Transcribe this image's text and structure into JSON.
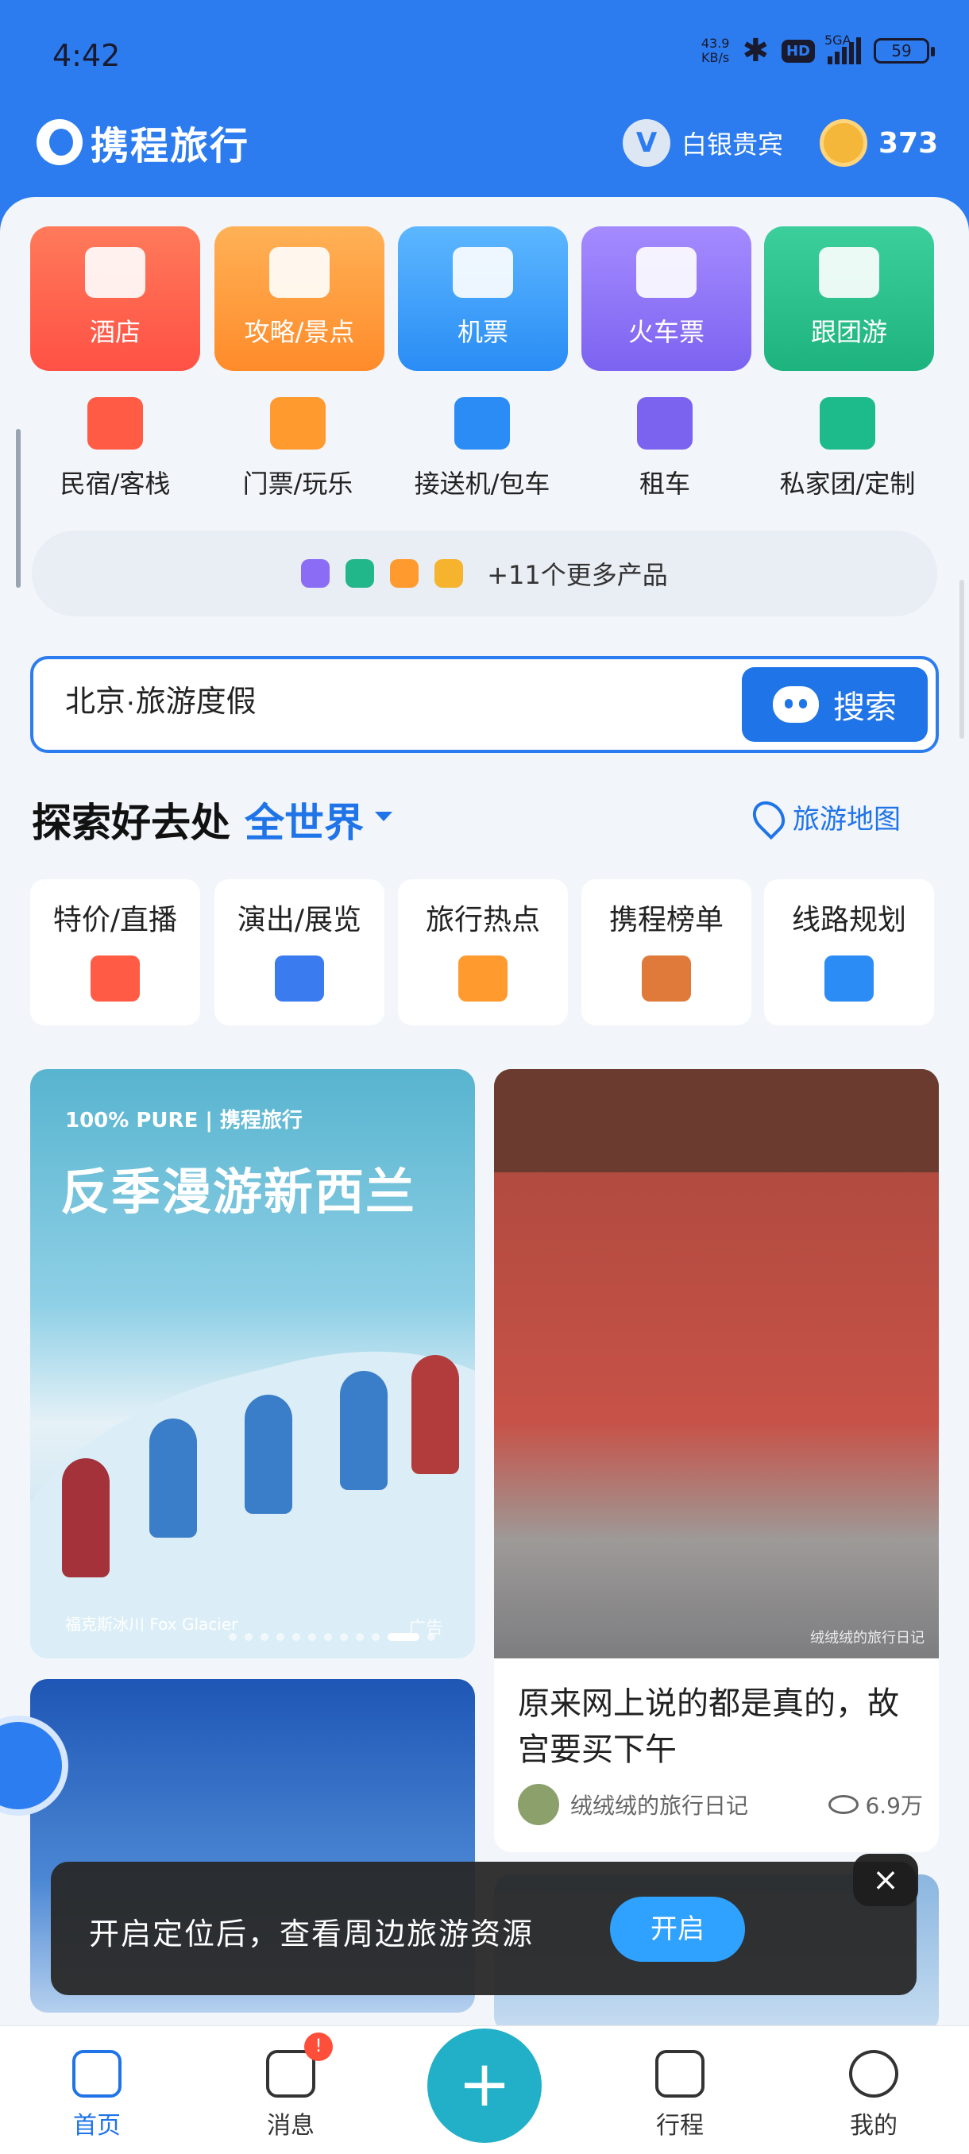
{
  "status_bar": {
    "time": "4:42",
    "net_speed_value": "43.9",
    "net_speed_unit": "KB/s",
    "hd": "HD",
    "signal": "5GA",
    "battery": "59"
  },
  "header": {
    "app_name": "携程旅行",
    "vip_badge": "V",
    "vip_level": "白银贵宾",
    "coins": "373"
  },
  "categories": [
    {
      "label": "酒店"
    },
    {
      "label": "攻略/景点"
    },
    {
      "label": "机票"
    },
    {
      "label": "火车票"
    },
    {
      "label": "跟团游"
    }
  ],
  "services": [
    {
      "label": "民宿/客栈"
    },
    {
      "label": "门票/玩乐"
    },
    {
      "label": "接送机/包车"
    },
    {
      "label": "租车"
    },
    {
      "label": "私家团/定制"
    }
  ],
  "more_products": "+11个更多产品",
  "search": {
    "value": "北京·旅游度假",
    "button": "搜索"
  },
  "explore": {
    "title": "探索好去处",
    "region": "全世界",
    "map_link": "旅游地图"
  },
  "explore_cards": [
    {
      "label": "特价/直播"
    },
    {
      "label": "演出/展览"
    },
    {
      "label": "旅行热点"
    },
    {
      "label": "携程榜单"
    },
    {
      "label": "线路规划"
    }
  ],
  "feed": {
    "ad": {
      "brand": "100% PURE | 携程旅行",
      "title": "反季漫游新西兰",
      "location": "福克斯冰川  Fox Glacier",
      "tag": "广告"
    },
    "post": {
      "watermark": "绒绒绒的旅行日记",
      "title": "原来网上说的都是真的，故宫要买下午",
      "author": "绒绒绒的旅行日记",
      "views": "6.9万"
    }
  },
  "toast": {
    "text": "开启定位后，查看周边旅游资源",
    "button": "开启",
    "close": "×"
  },
  "bottom_nav": [
    {
      "label": "首页"
    },
    {
      "label": "消息",
      "badge": "!"
    },
    {
      "label": "+"
    },
    {
      "label": "行程"
    },
    {
      "label": "我的"
    }
  ],
  "colors": {
    "brand_blue": "#2c7cf0",
    "link_blue": "#1f74e8",
    "fab_teal": "#22b0c8",
    "badge_red": "#ff4f3a"
  }
}
